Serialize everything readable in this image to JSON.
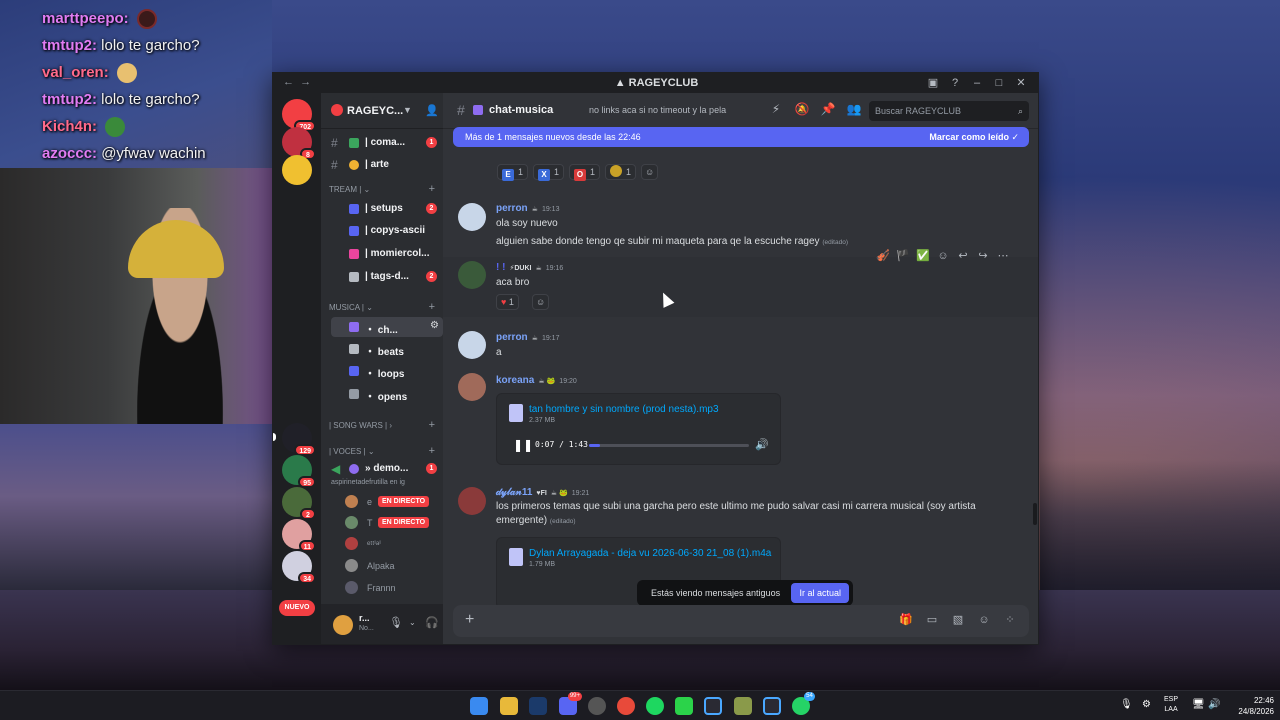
{
  "stream_chat": [
    {
      "user": "marttpeepo:",
      "message": "",
      "emote": "dark-circle-emote",
      "user_color": "#e17cf3"
    },
    {
      "user": "tmtup2:",
      "message": "lolo te garcho?",
      "emote": "",
      "user_color": "#e17cf3"
    },
    {
      "user": "val_oren:",
      "message": "",
      "emote": "shiba-emote",
      "user_color": "#ff6a8b"
    },
    {
      "user": "tmtup2:",
      "message": "lolo te garcho?",
      "emote": "",
      "user_color": "#e17cf3"
    },
    {
      "user": "Kich4n:",
      "message": "",
      "emote": "frog-emote",
      "user_color": "#ff6a8b"
    },
    {
      "user": "azoccc:",
      "message": "@yfwav wachin",
      "emote": "",
      "user_color": "#e17cf3"
    }
  ],
  "window": {
    "title": "RAGEYCLUB",
    "back": "←",
    "forward": "→"
  },
  "guilds": {
    "badges": [
      "702",
      "8",
      "129",
      "95",
      "2",
      "11",
      "34"
    ],
    "new_label": "NUEVO"
  },
  "server": {
    "name": "RAGEYC...",
    "channels": [
      {
        "label": "| coma...",
        "badge": "1",
        "color": "#3ba55d"
      },
      {
        "label": "| arte",
        "badge": "",
        "color": "#f0b232"
      },
      {
        "label": "| setups",
        "badge": "2",
        "color": "#5865f2"
      },
      {
        "label": "| copys-ascii",
        "badge": "",
        "color": "#5865f2"
      },
      {
        "label": "| momiercol...",
        "badge": "",
        "color": "#eb459e"
      },
      {
        "label": "| tags-d...",
        "badge": "2",
        "color": "#b5bac1"
      }
    ],
    "cat_stream": "TREAM |",
    "cat_musica": "MUSICA |",
    "music_channels": [
      {
        "label": "・ ch...",
        "color": "#8e6cf0"
      },
      {
        "label": "・ beats",
        "color": "#b5bac1"
      },
      {
        "label": "・ loops",
        "color": "#5865f2"
      },
      {
        "label": "・ opens",
        "color": "#b5bac1"
      }
    ],
    "cat_songwars": "| SONG WARS |",
    "cat_voces": "| VOCES |",
    "voice_channel": {
      "label": "» demo...",
      "badge": "1",
      "subtitle": "aspirinetadefrutilla en ig"
    },
    "voice_users": [
      {
        "name": "e",
        "live": "EN DIRECTO"
      },
      {
        "name": "T",
        "live": "EN DIRECTO"
      },
      {
        "name": "ᵉᵗᵗⁱᵃⁱ",
        "live": ""
      },
      {
        "name": "Alpaka",
        "live": ""
      },
      {
        "name": "Frannn",
        "live": ""
      }
    ]
  },
  "user_panel": {
    "name": "r...",
    "status": "No..."
  },
  "channel": {
    "name": "chat-musica",
    "topic": "no links aca si no timeout y la pela",
    "search_placeholder": "Buscar RAGEYCLUB"
  },
  "new_messages_bar": {
    "text": "Más de 1 mensajes nuevos desde las 22:46",
    "action": "Marcar como leído"
  },
  "top_reactions": [
    {
      "glyph": "E",
      "count": "1",
      "color": "#3a6ad8"
    },
    {
      "glyph": "X",
      "count": "1",
      "color": "#3a6ad8"
    },
    {
      "glyph": "O",
      "count": "1",
      "color": "#d83a3a"
    },
    {
      "glyph": "",
      "count": "1",
      "color": "#c9a227"
    }
  ],
  "messages": [
    {
      "author": "perron",
      "time": "19:13",
      "color": "#7aa2f7",
      "lines": [
        "ola soy nuevo",
        "alguien sabe donde tengo qe subir mi maqueta para qe la escuche ragey"
      ],
      "edited": "(editado)"
    },
    {
      "author": "! !",
      "tag": "⚡DUKI",
      "time": "19:16",
      "color": "#5865f2",
      "lines": [
        "aca bro"
      ],
      "reaction_count": "1"
    },
    {
      "author": "perron",
      "time": "19:17",
      "color": "#7aa2f7",
      "lines": [
        "a"
      ]
    },
    {
      "author": "koreana",
      "time": "19:20",
      "color": "#7aa2f7",
      "attachment": {
        "name": "tan hombre y sin nombre (prod nesta).mp3",
        "size": "2.37 MB",
        "current": "0:07 / 1:43",
        "progress": 0.07
      }
    },
    {
      "author": "𝒹𝓎𝓁𝒶𝓃11",
      "tag": "♥FI",
      "time": "19:21",
      "color": "#7aa2f7",
      "lines": [
        "los primeros temas que subi una garcha pero este ultimo me pudo salvar casi mi carrera musical (soy artista",
        "emergente)"
      ],
      "edited": "(editado)",
      "attachment": {
        "name": "Dylan Arrayagada - deja vu 2026-06-30 21_08 (1).m4a",
        "size": "1.79 MB",
        "current": "-:-- / -:--",
        "progress": 0
      }
    }
  ],
  "toast": {
    "text": "Estás viendo mensajes antiguos",
    "button": "Ir al actual"
  },
  "taskbar": {
    "lang_top": "ESP",
    "lang_bottom": "LAA",
    "time": "22:46",
    "date": "24/8/2026",
    "discord_badge": "99+",
    "whatsapp_badge": "54"
  }
}
